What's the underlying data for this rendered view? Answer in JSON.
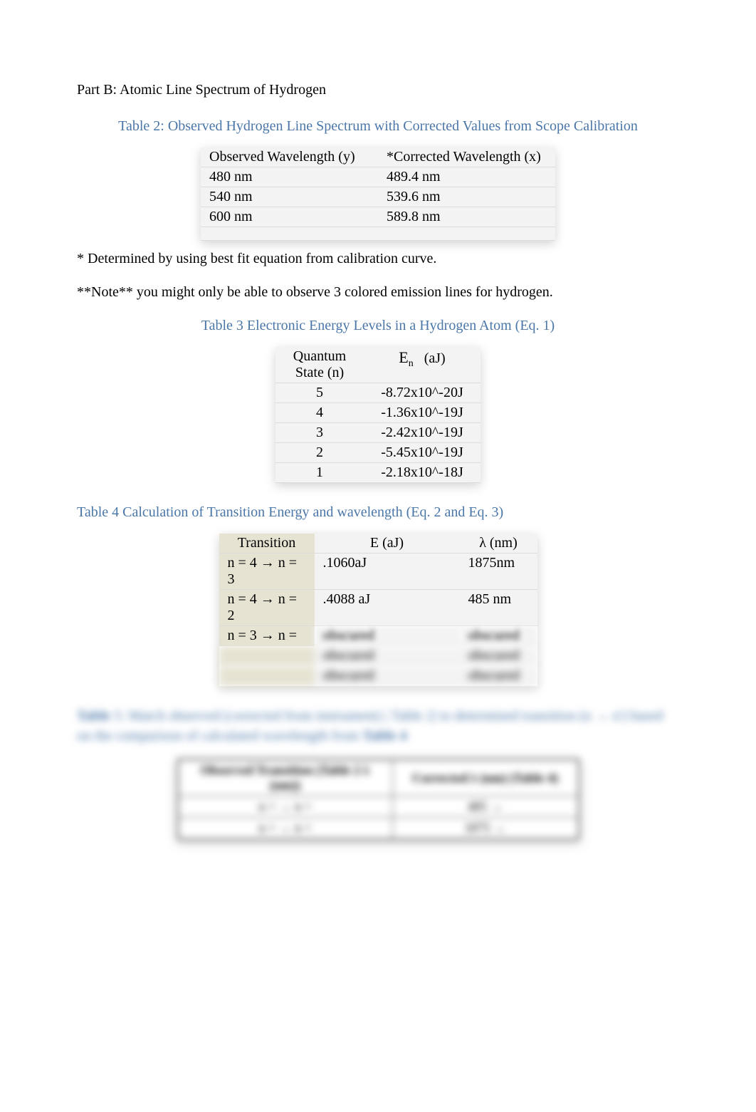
{
  "partB": {
    "title": "Part B:  Atomic Line Spectrum of Hydrogen"
  },
  "table2": {
    "caption": "Table 2: Observed Hydrogen Line Spectrum with Corrected Values from Scope Calibration",
    "headers": {
      "col1": "Observed Wavelength (y)",
      "col2": "*Corrected Wavelength (x)"
    },
    "rows": [
      {
        "c1": "480 nm",
        "c2": "489.4 nm"
      },
      {
        "c1": "540 nm",
        "c2": "539.6 nm"
      },
      {
        "c1": "600 nm",
        "c2": "589.8 nm"
      }
    ],
    "footnote1": "* Determined by using best fit equation from calibration curve.",
    "footnote2": "**Note** you might only be able to observe 3 colored emission lines for hydrogen."
  },
  "table3": {
    "caption": "Table 3 Electronic Energy Levels in a Hydrogen Atom (Eq. 1)",
    "headers": {
      "col1_top": "Quantum",
      "col1_bot": "State (n)",
      "col2_pre": "E",
      "col2_sub": "n",
      "col2_post": "(aJ)"
    },
    "rows": [
      {
        "n": "5",
        "e": "-8.72x10^-20J"
      },
      {
        "n": "4",
        "e": "-1.36x10^-19J"
      },
      {
        "n": "3",
        "e": "-2.42x10^-19J"
      },
      {
        "n": "2",
        "e": "-5.45x10^-19J"
      },
      {
        "n": "1",
        "e": "-2.18x10^-18J"
      }
    ]
  },
  "table4": {
    "caption": "Table 4 Calculation of Transition Energy and wavelength (Eq. 2 and Eq. 3)",
    "headers": {
      "col1": "Transition",
      "col2": "E (aJ)",
      "col3": "λ (nm)"
    },
    "rows": [
      {
        "t": "n = 4 → n = 3",
        "e": ".1060aJ",
        "w": "1875nm"
      },
      {
        "t": "n = 4 → n = 2",
        "e": ".4088 aJ",
        "w": "485 nm"
      },
      {
        "t": "n = 3 → n =",
        "e": "",
        "w": ""
      },
      {
        "t": "",
        "e": "obscured",
        "w": "obscured"
      },
      {
        "t": "",
        "e": "obscured",
        "w": "obscured"
      },
      {
        "t": "",
        "e": "obscured",
        "w": "obscured"
      }
    ]
  },
  "table5": {
    "caption_pre": "Table",
    "caption_text": " 5: Match observed (corrected from instrument) | Table 2| to determined transition (n → n') based on the comparison of calculated wavelength from ",
    "caption_post": "Table 4",
    "headers": {
      "col1": "Observed Transition (Table 2 λ (nm))",
      "col2": "Corrected λ (nm) (Table 4)"
    },
    "rows": [
      {
        "c1": "n =  →  n = ",
        "c2": "485 → "
      },
      {
        "c1": "n =  →  n = ",
        "c2": "1875 → "
      }
    ]
  }
}
